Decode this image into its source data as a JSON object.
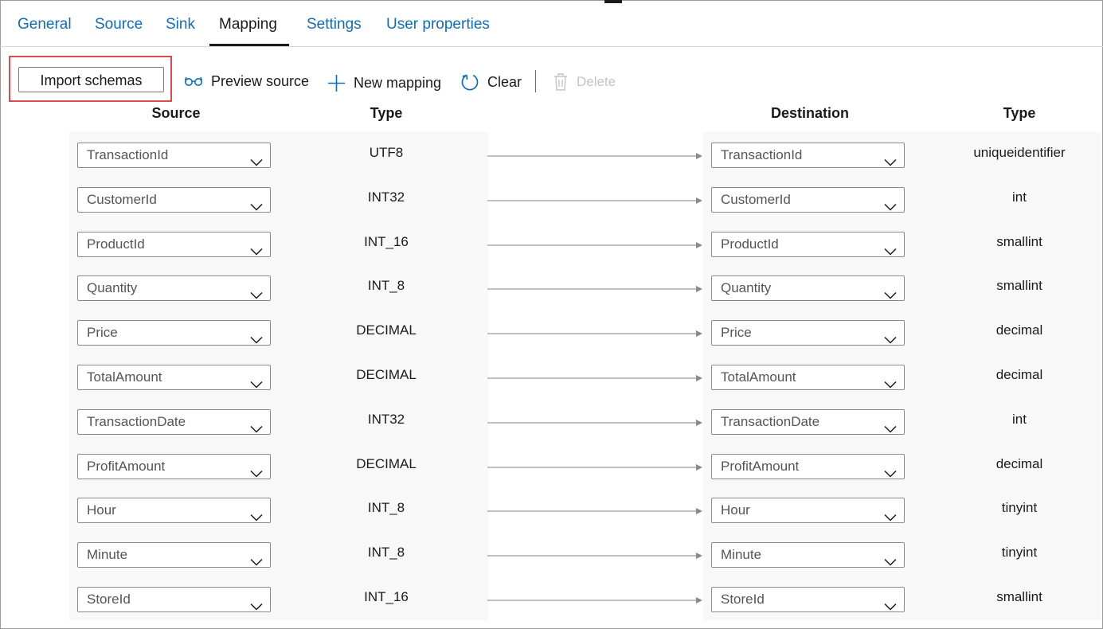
{
  "tabs": [
    {
      "label": "General"
    },
    {
      "label": "Source"
    },
    {
      "label": "Sink"
    },
    {
      "label": "Mapping"
    },
    {
      "label": "Settings"
    },
    {
      "label": "User properties"
    }
  ],
  "active_tab": "Mapping",
  "toolbar": {
    "import_label": "Import schemas",
    "preview_label": "Preview source",
    "new_mapping_label": "New mapping",
    "clear_label": "Clear",
    "delete_label": "Delete"
  },
  "columns": {
    "source": "Source",
    "source_type": "Type",
    "destination": "Destination",
    "destination_type": "Type"
  },
  "colors": {
    "accent": "#0f6cbd",
    "highlight": "#e0484d",
    "disabled": "#c4c4c4"
  },
  "mappings": [
    {
      "source": "TransactionId",
      "source_type": "UTF8",
      "destination": "TransactionId",
      "destination_type": "uniqueidentifier"
    },
    {
      "source": "CustomerId",
      "source_type": "INT32",
      "destination": "CustomerId",
      "destination_type": "int"
    },
    {
      "source": "ProductId",
      "source_type": "INT_16",
      "destination": "ProductId",
      "destination_type": "smallint"
    },
    {
      "source": "Quantity",
      "source_type": "INT_8",
      "destination": "Quantity",
      "destination_type": "smallint"
    },
    {
      "source": "Price",
      "source_type": "DECIMAL",
      "destination": "Price",
      "destination_type": "decimal"
    },
    {
      "source": "TotalAmount",
      "source_type": "DECIMAL",
      "destination": "TotalAmount",
      "destination_type": "decimal"
    },
    {
      "source": "TransactionDate",
      "source_type": "INT32",
      "destination": "TransactionDate",
      "destination_type": "int"
    },
    {
      "source": "ProfitAmount",
      "source_type": "DECIMAL",
      "destination": "ProfitAmount",
      "destination_type": "decimal"
    },
    {
      "source": "Hour",
      "source_type": "INT_8",
      "destination": "Hour",
      "destination_type": "tinyint"
    },
    {
      "source": "Minute",
      "source_type": "INT_8",
      "destination": "Minute",
      "destination_type": "tinyint"
    },
    {
      "source": "StoreId",
      "source_type": "INT_16",
      "destination": "StoreId",
      "destination_type": "smallint"
    }
  ]
}
